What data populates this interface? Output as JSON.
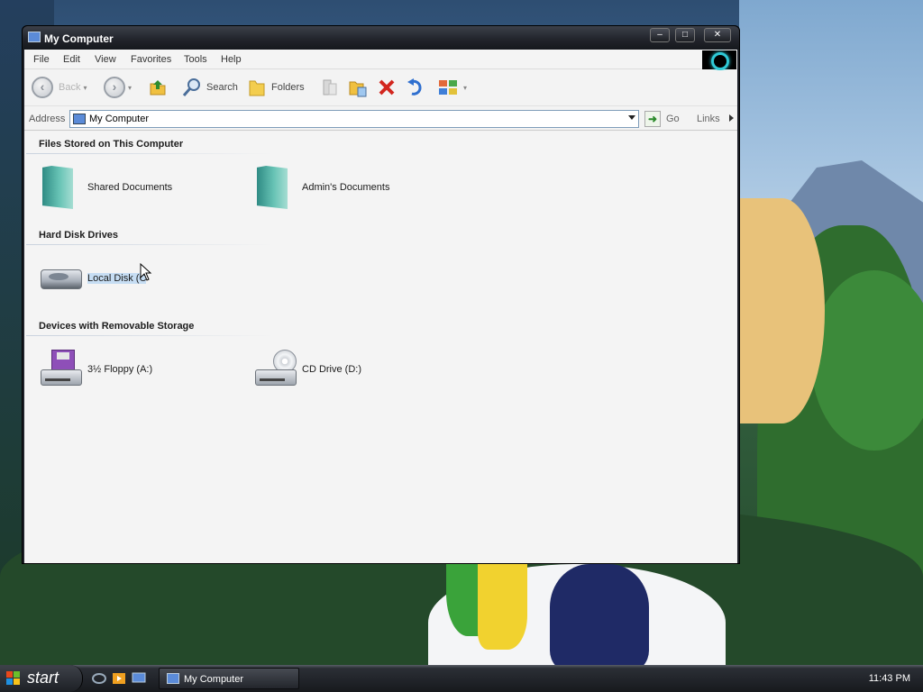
{
  "window": {
    "title": "My Computer",
    "controls": {
      "minimize": "–",
      "maximize": "□",
      "close": "✕"
    }
  },
  "menu": [
    "File",
    "Edit",
    "View",
    "Favorites",
    "Tools",
    "Help"
  ],
  "toolbar": {
    "back_label": "Back",
    "search_label": "Search",
    "folders_label": "Folders"
  },
  "address": {
    "label": "Address",
    "value": "My Computer",
    "go_label": "Go",
    "links_label": "Links"
  },
  "groups": [
    {
      "header": "Files Stored on This Computer",
      "items": [
        {
          "label": "Shared Documents",
          "icon": "folder-icon"
        },
        {
          "label": "Admin's Documents",
          "icon": "folder-icon"
        }
      ]
    },
    {
      "header": "Hard Disk Drives",
      "items": [
        {
          "label": "Local Disk (C",
          "icon": "hard-disk-icon",
          "selected": true
        }
      ]
    },
    {
      "header": "Devices with Removable Storage",
      "items": [
        {
          "label": "3½ Floppy (A:)",
          "icon": "floppy-drive-icon"
        },
        {
          "label": "CD Drive (D:)",
          "icon": "cd-drive-icon"
        }
      ]
    }
  ],
  "taskbar": {
    "start_label": "start",
    "task_label": "My Computer",
    "clock": "11:43 PM"
  },
  "colors": {
    "selection": "#c6ddf3",
    "titlebar": "#22252c",
    "accent": "#2fc9d6"
  }
}
